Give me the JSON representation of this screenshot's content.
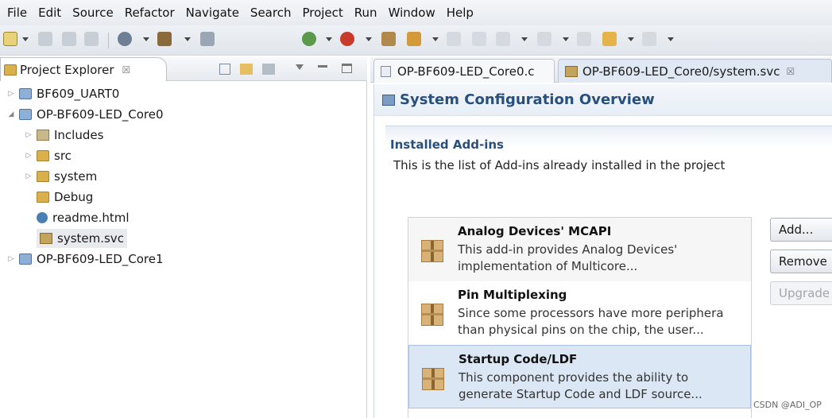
{
  "menubar": [
    "File",
    "Edit",
    "Source",
    "Refactor",
    "Navigate",
    "Search",
    "Project",
    "Run",
    "Window",
    "Help"
  ],
  "project_explorer": {
    "title": "Project Explorer",
    "close": "☒",
    "tree": [
      {
        "label": "BF609_UART0",
        "kind": "project",
        "expanded": false
      },
      {
        "label": "OP-BF609-LED_Core0",
        "kind": "project",
        "expanded": true
      },
      {
        "label": "Includes",
        "kind": "includes",
        "expanded": false
      },
      {
        "label": "src",
        "kind": "folder",
        "expanded": false
      },
      {
        "label": "system",
        "kind": "folder",
        "expanded": false
      },
      {
        "label": "Debug",
        "kind": "folder"
      },
      {
        "label": "readme.html",
        "kind": "html"
      },
      {
        "label": "system.svc",
        "kind": "svc",
        "selected": true
      },
      {
        "label": "OP-BF609-LED_Core1",
        "kind": "project",
        "expanded": false
      }
    ]
  },
  "editor": {
    "tabs": [
      {
        "label": "OP-BF609-LED_Core0.c"
      },
      {
        "label": "OP-BF609-LED_Core0/system.svc",
        "active": true,
        "close": "☒"
      }
    ],
    "page_title": "System Configuration Overview",
    "section_heading": "Installed Add-ins",
    "section_desc": "This is the list of Add-ins already installed in the project",
    "addins": [
      {
        "name": "Analog Devices' MCAPI",
        "desc_lines": [
          "This add-in provides Analog Devices'",
          "implementation of Multicore..."
        ]
      },
      {
        "name": "Pin Multiplexing",
        "desc_lines": [
          "Since some processors have more periphera",
          "than physical pins on the chip, the user..."
        ]
      },
      {
        "name": "Startup Code/LDF",
        "desc_lines": [
          "This component provides the ability to",
          "generate Startup Code and LDF source..."
        ],
        "selected": true
      }
    ],
    "buttons": [
      {
        "label": "Add...",
        "enabled": true
      },
      {
        "label": "Remove",
        "enabled": true
      },
      {
        "label": "Upgrade",
        "enabled": false
      }
    ]
  },
  "watermark": "CSDN @ADI_OP"
}
